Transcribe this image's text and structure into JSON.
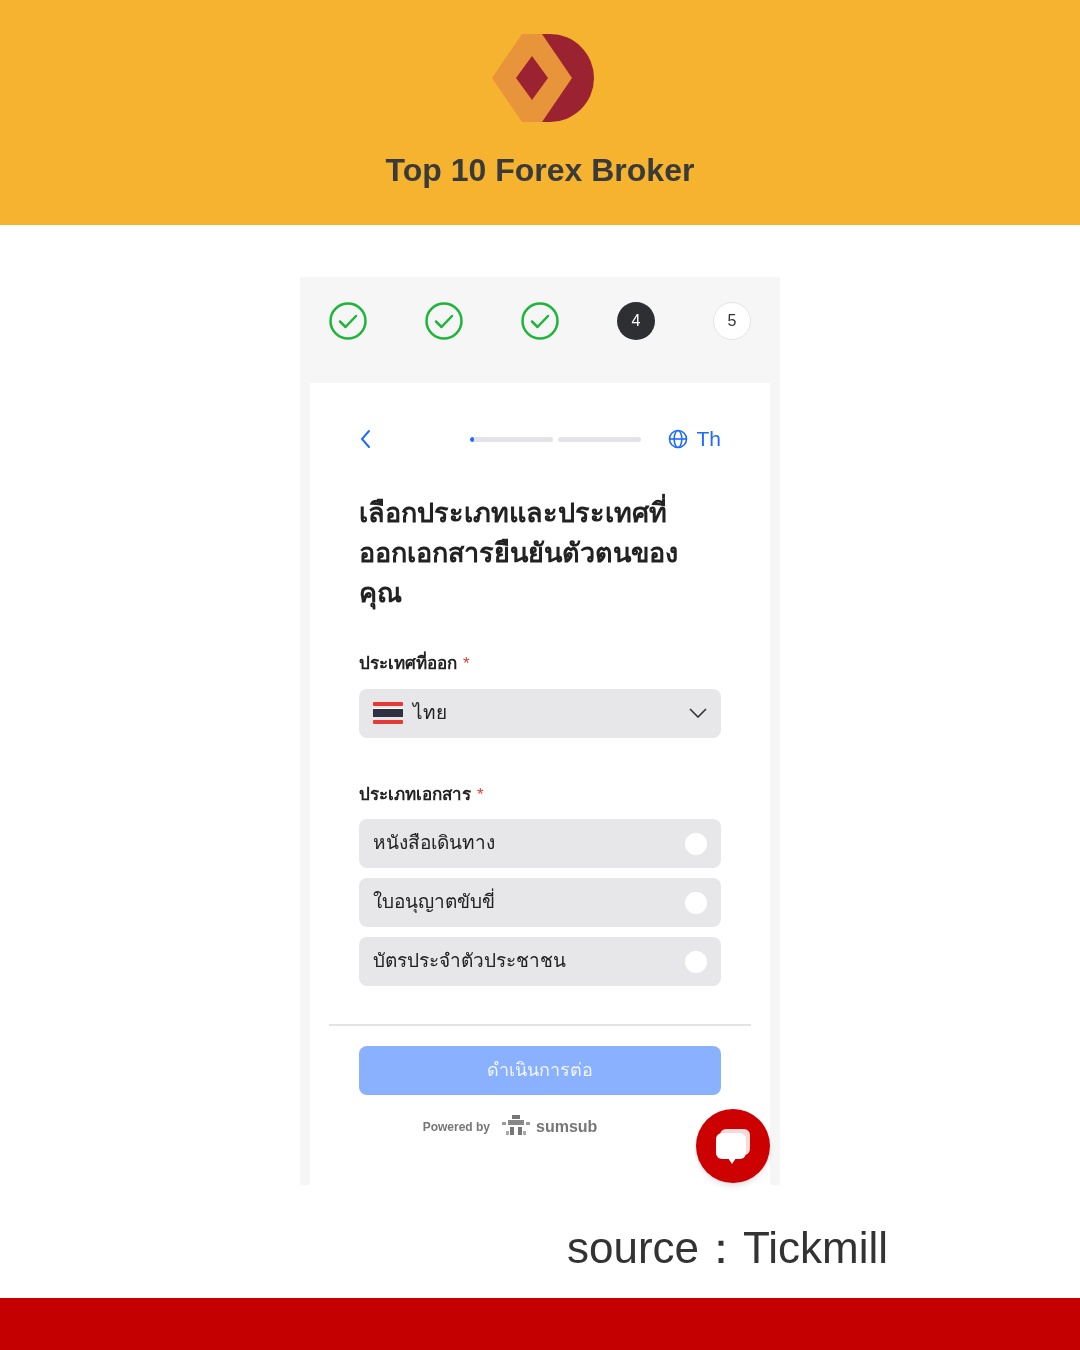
{
  "banner": {
    "title": "Top 10 Forex Broker"
  },
  "steps": [
    {
      "kind": "done"
    },
    {
      "kind": "done"
    },
    {
      "kind": "done"
    },
    {
      "kind": "current",
      "label": "4"
    },
    {
      "kind": "pending",
      "label": "5"
    }
  ],
  "nav": {
    "progress": {
      "level": 0.05
    },
    "language": "Th"
  },
  "heading": "เลือกประเภทและประเทศที่ออกเอกสารยืนยันตัวตนของคุณ",
  "country": {
    "label": "ประเทศที่ออก",
    "required_mark": "*",
    "value": "ไทย"
  },
  "document_type": {
    "label": "ประเภทเอกสาร",
    "required_mark": "*",
    "options": [
      {
        "label": "หนังสือเดินทาง",
        "selected": false
      },
      {
        "label": "ใบอนุญาตขับขี่",
        "selected": false
      },
      {
        "label": "บัตรประจำตัวประชาชน",
        "selected": false
      }
    ]
  },
  "continue_button": {
    "label": "ดำเนินการต่อ",
    "disabled": true
  },
  "footer": {
    "powered_by": "Powered by",
    "brand": "sumsub"
  },
  "source": "source：Tickmill"
}
